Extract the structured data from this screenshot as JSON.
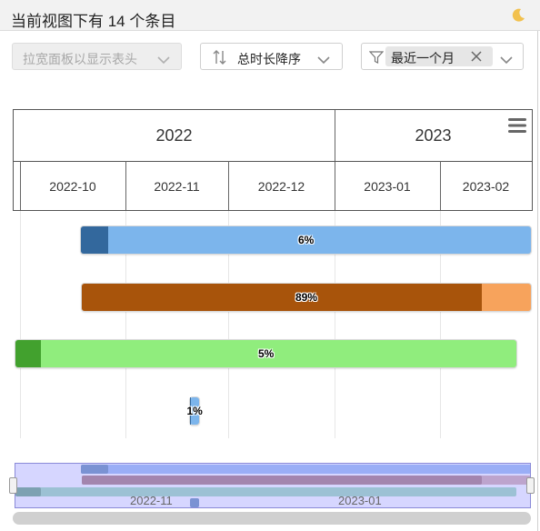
{
  "header": {
    "title": "当前视图下有 14 个条目",
    "theme_icon": "moon-icon"
  },
  "toolbar": {
    "columns_label": "拉宽面板以显示表头",
    "sort_label": "总时长降序",
    "filter_chip_label": "最近一个月"
  },
  "gantt": {
    "years": [
      "2022",
      "2023"
    ],
    "months": [
      "2022-10",
      "2022-11",
      "2022-12",
      "2023-01",
      "2023-02"
    ],
    "tasks": [
      {
        "progress_label": "6%",
        "progress": 0.06,
        "color_fill": "#7cb5ec",
        "color_done": "#33689d"
      },
      {
        "progress_label": "89%",
        "progress": 0.89,
        "color_fill": "#f7a35c",
        "color_done": "#a8540b"
      },
      {
        "progress_label": "5%",
        "progress": 0.05,
        "color_fill": "#90ed7d",
        "color_done": "#42a12e"
      },
      {
        "progress_label": "1%",
        "progress": 0.01,
        "color_fill": "#7cb5ec",
        "color_done": "#33689d"
      }
    ]
  },
  "navigator": {
    "labels": [
      "2022-11",
      "2023-01"
    ]
  },
  "colors": {
    "navigator_selection": "#b4b4ff"
  }
}
